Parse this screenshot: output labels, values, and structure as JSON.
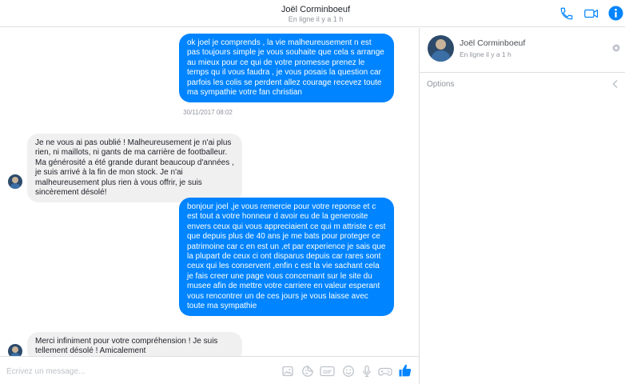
{
  "header": {
    "name": "Joël Corminboeuf",
    "status": "En ligne il y a 1 h",
    "icons": [
      "phone-icon",
      "video-camera-icon",
      "info-icon"
    ],
    "accent_color": "#0084ff"
  },
  "messages": [
    {
      "direction": "out",
      "text": "ok joel je comprends  , la vie malheureusement n est pas toujours simple je vous souhaite que cela s arrange au mieux pour ce qui de votre promesse prenez le temps qu il vous faudra , je vous posais la question car parfois les colis se perdent allez courage recevez toute ma sympathie votre fan christian"
    },
    {
      "direction": "in",
      "text": "Je ne vous ai pas oublié ! Malheureusement je n'ai plus rien, ni maillots, ni gants de ma carrière de footballeur. Ma générosité a été grande durant beaucoup d'années , je suis arrivé à la fin de mon stock. Je n'ai malheureusement plus rien à vous offrir, je suis sincèrement désolé!"
    },
    {
      "direction": "out",
      "text": "bonjour joel  ,je vous remercie pour votre reponse et c est tout a votre honneur d avoir eu de la generosite envers ceux qui vous appreciaient  ce qui m attriste c est que depuis plus de 40 ans je me bats pour proteger ce patrimoine car c en est un  ,et par experience je sais que la plupart de ceux ci  ont  disparus depuis car rares sont ceux qui les conservent  ,enfin c est la vie sachant cela je fais creer  une page vous concernant sur le site du musee  afin de  mettre votre carriere en valeur  esperant vous rencontrer un de ces jours je vous laisse avec toute ma sympathie"
    },
    {
      "direction": "in",
      "text": "Merci infiniment pour votre compréhension ! Je suis tellement désolé ! Amicalement"
    }
  ],
  "timestamp": "30/11/2017 08:02",
  "composer": {
    "placeholder": "Écrivez un message...",
    "icons": [
      "photo-icon",
      "sticker-icon",
      "gif-icon",
      "emoji-icon",
      "microphone-icon",
      "game-icon",
      "like-icon"
    ]
  },
  "sidebar": {
    "name": "Joël Corminboeuf",
    "status": "En ligne il y a 1 h",
    "options_label": "Options"
  },
  "colors": {
    "outgoing": "#0084ff",
    "incoming": "#f1f0f0",
    "muted": "#90949c"
  }
}
